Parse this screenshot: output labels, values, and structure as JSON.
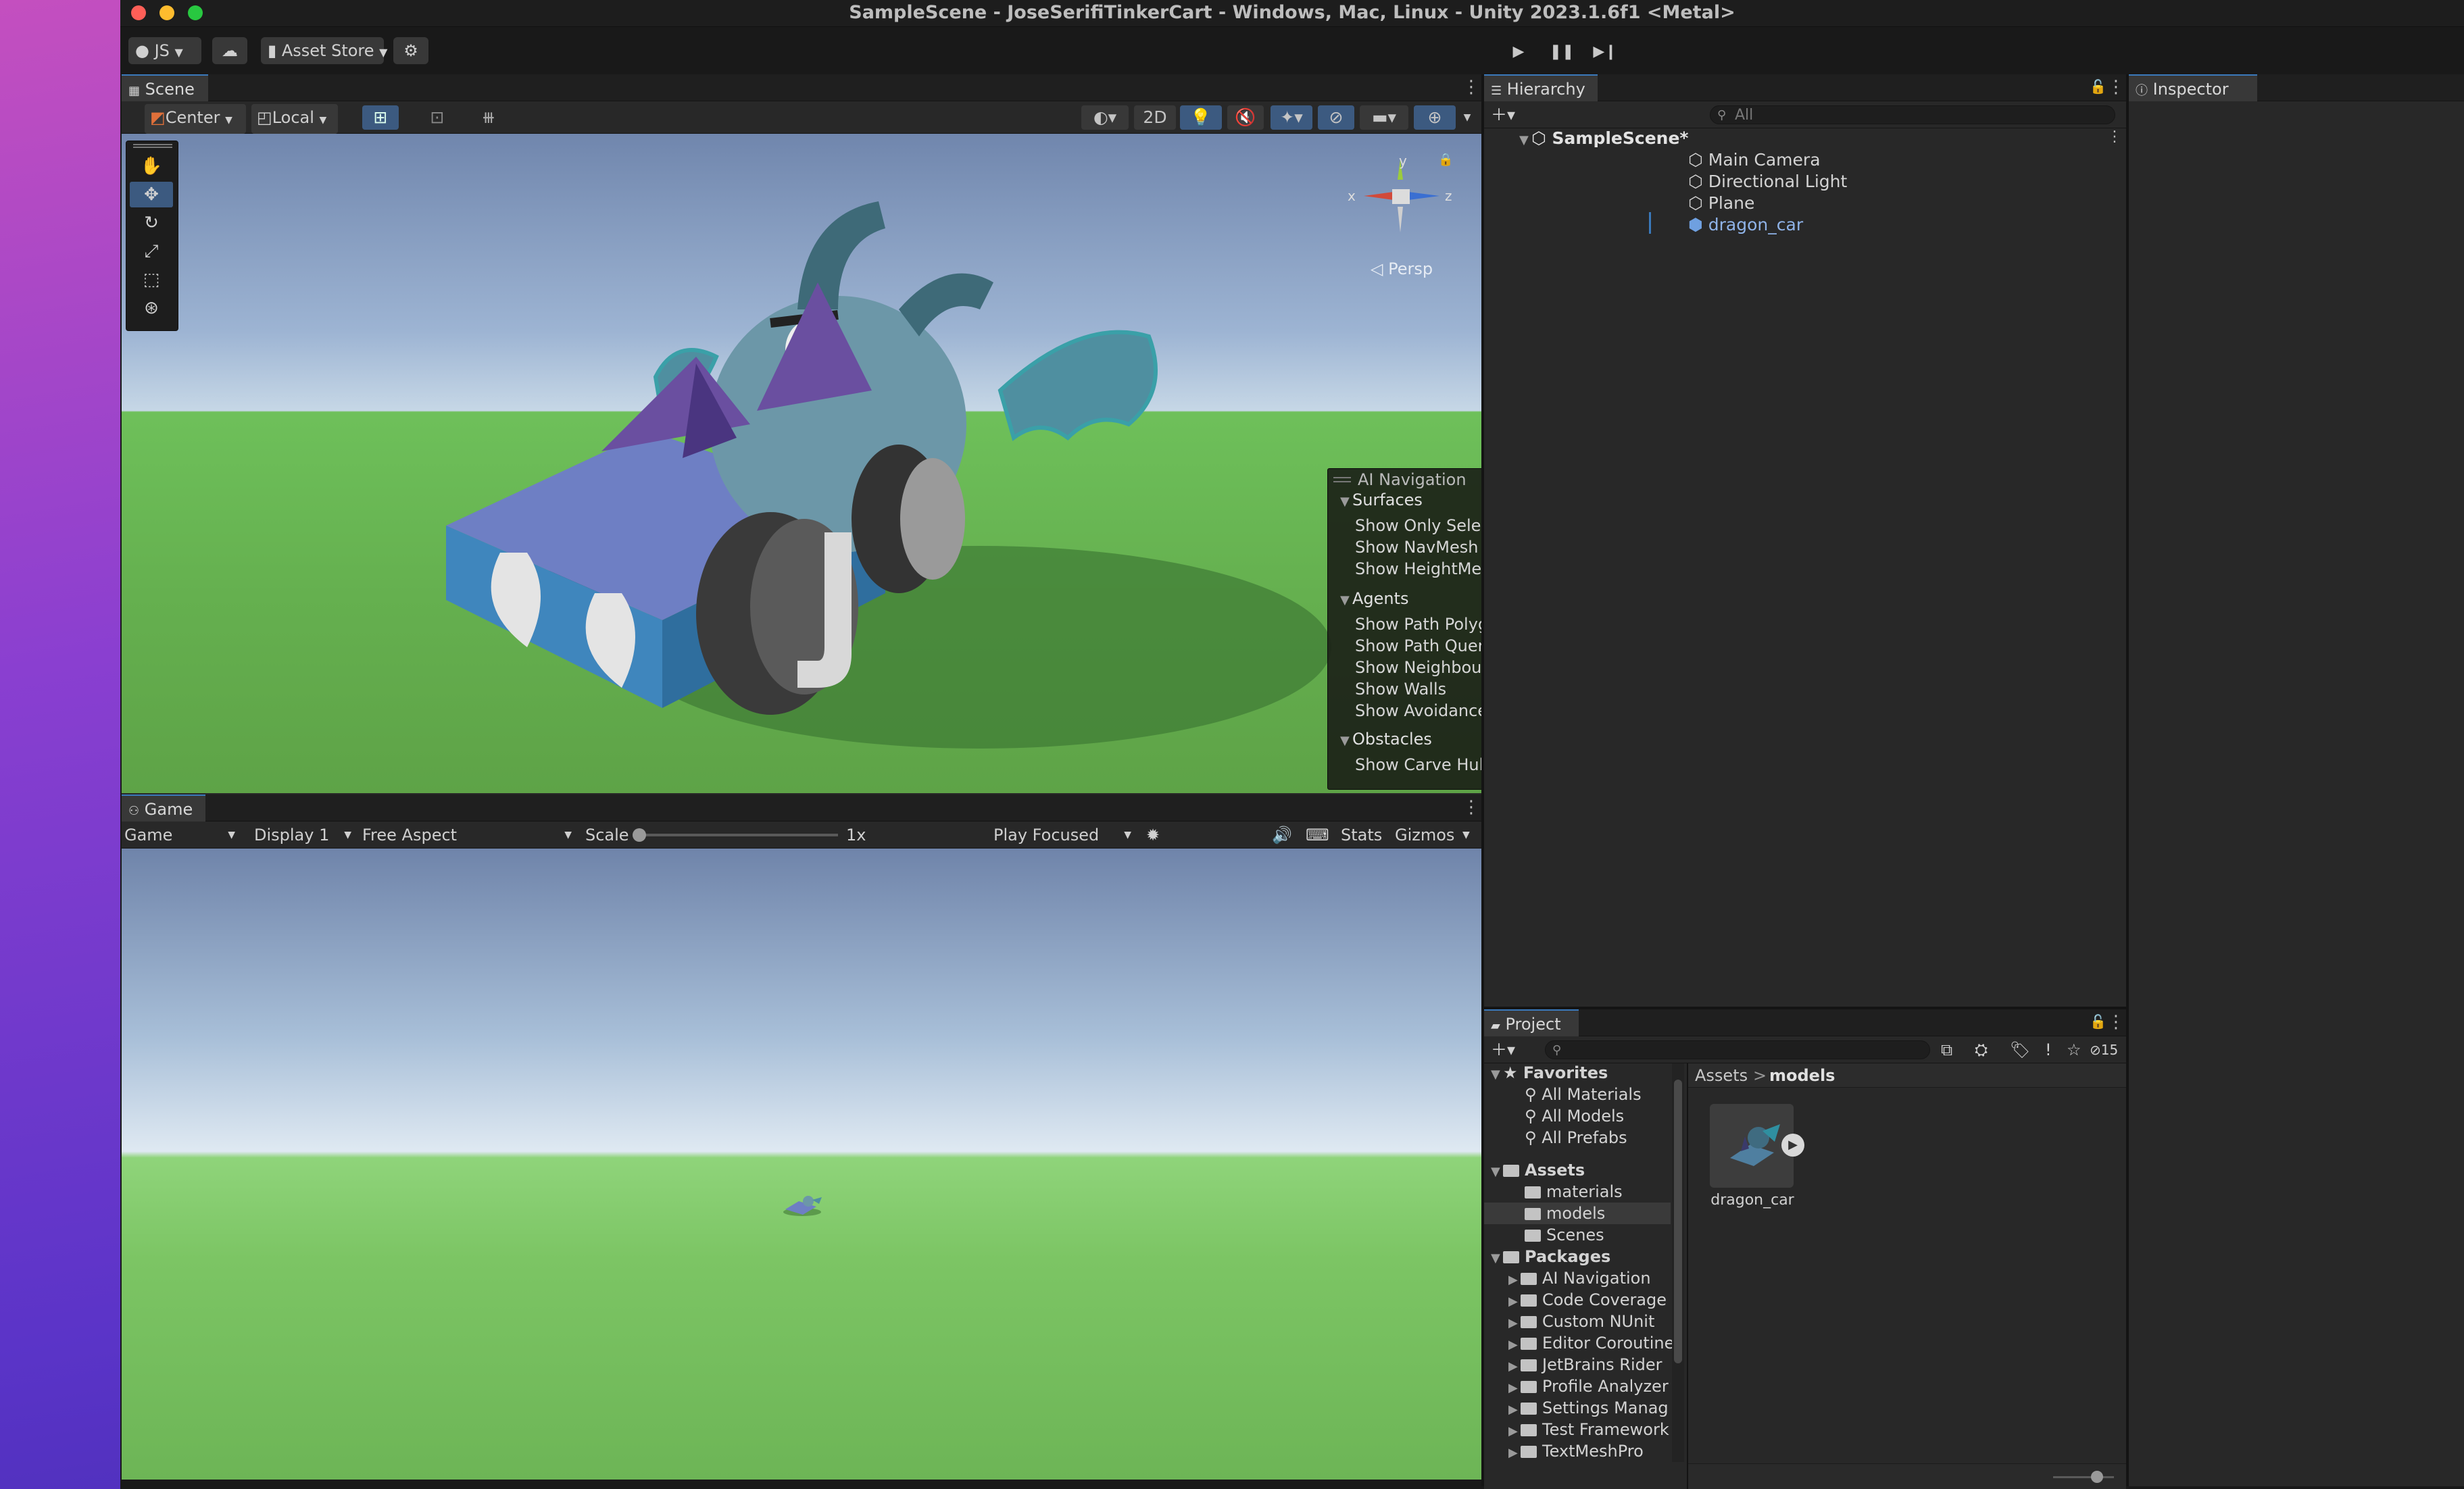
{
  "window": {
    "title": "SampleScene - JoseSerifiTinkerCart - Windows, Mac, Linux - Unity 2023.1.6f1 <Metal>"
  },
  "toolbar": {
    "account": "JS",
    "asset_store": "Asset Store",
    "play_icon": "play-icon",
    "pause_icon": "pause-icon",
    "step_icon": "step-icon"
  },
  "scene": {
    "tab": "Scene",
    "pivot": "Center",
    "space": "Local",
    "mode_2d": "2D",
    "persp_label": "◁ Persp",
    "gizmo_axes": {
      "x": "x",
      "y": "y",
      "z": "z"
    }
  },
  "ai_navigation": {
    "title": "AI Navigation",
    "sections": [
      {
        "label": "Surfaces",
        "items": [
          {
            "label": "Show Only Selected",
            "checked": false
          },
          {
            "label": "Show NavMesh",
            "checked": true
          },
          {
            "label": "Show HeightMesh",
            "checked": false
          }
        ]
      },
      {
        "label": "Agents",
        "items": [
          {
            "label": "Show Path Polygons",
            "checked": true
          },
          {
            "label": "Show Path Query Nodes",
            "checked": false
          },
          {
            "label": "Show Neighbours",
            "checked": false
          },
          {
            "label": "Show Walls",
            "checked": false
          },
          {
            "label": "Show Avoidance",
            "checked": false
          }
        ]
      },
      {
        "label": "Obstacles",
        "items": [
          {
            "label": "Show Carve Hull",
            "checked": false
          }
        ]
      }
    ]
  },
  "game": {
    "tab": "Game",
    "view_mode": "Game",
    "display": "Display 1",
    "aspect": "Free Aspect",
    "scale_label": "Scale",
    "scale_value": "1x",
    "scale_fraction": 0.0,
    "play_mode": "Play Focused",
    "stats": "Stats",
    "gizmos": "Gizmos"
  },
  "hierarchy": {
    "tab": "Hierarchy",
    "search_placeholder": "All",
    "scene_name": "SampleScene*",
    "items": [
      "Main Camera",
      "Directional Light",
      "Plane",
      "dragon_car"
    ]
  },
  "inspector": {
    "tab": "Inspector"
  },
  "project": {
    "tab": "Project",
    "hidden_count": "15",
    "favorites": {
      "label": "Favorites",
      "items": [
        "All Materials",
        "All Models",
        "All Prefabs"
      ]
    },
    "assets": {
      "label": "Assets",
      "items": [
        "materials",
        "models",
        "Scenes"
      ]
    },
    "packages": {
      "label": "Packages",
      "items": [
        "AI Navigation",
        "Code Coverage",
        "Custom NUnit",
        "Editor Coroutine",
        "JetBrains Rider",
        "Profile Analyzer",
        "Settings Manag",
        "Test Framework",
        "TextMeshPro"
      ]
    },
    "breadcrumb": {
      "root": "Assets",
      "sep": ">",
      "current": "models"
    },
    "grid_items": [
      {
        "label": "dragon_car"
      }
    ]
  },
  "colors": {
    "accent": "#3a79bb",
    "selected_item": "#8fb3e8",
    "editor_bg": "#282828"
  }
}
